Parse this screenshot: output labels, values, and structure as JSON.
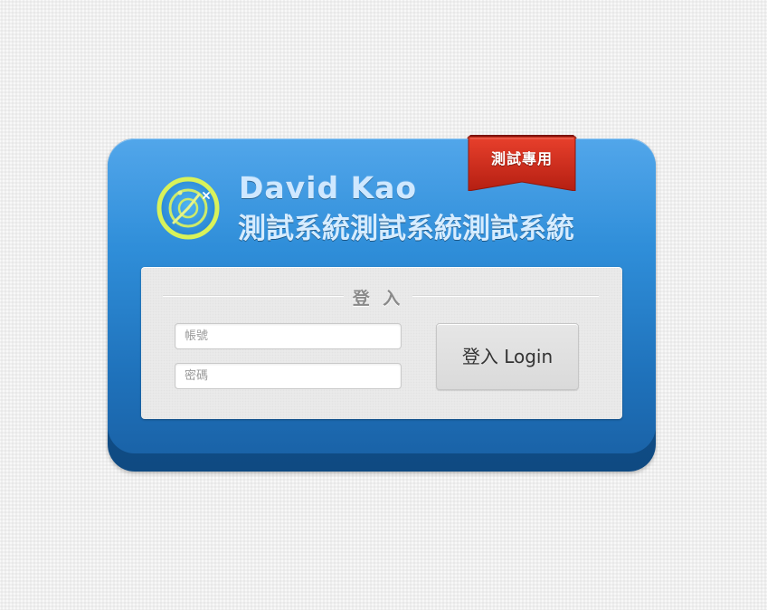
{
  "ribbon": {
    "label": "測試專用",
    "color": "#c8281a"
  },
  "header": {
    "logo_icon": "radar-icon",
    "brand_name": "David Kao",
    "system_title": "測試系統測試系統測試系統"
  },
  "login": {
    "title": "登 入",
    "account_placeholder": "帳號",
    "password_placeholder": "密碼",
    "button_label": "登入 Login"
  },
  "colors": {
    "card_blue": "#2f8ed9",
    "card_blue_dark": "#145a99",
    "panel_bg": "#ececec",
    "logo_ring": "#d8f25a"
  }
}
